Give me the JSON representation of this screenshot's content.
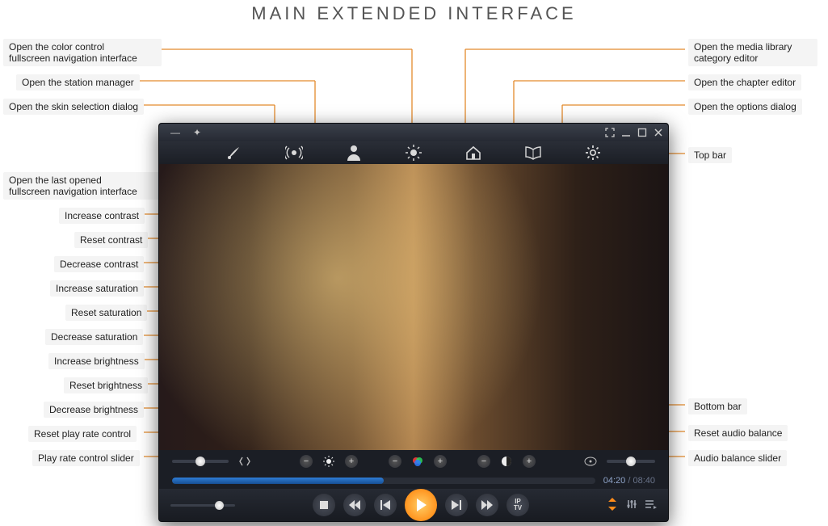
{
  "page_title": "MAIN EXTENDED INTERFACE",
  "labels": {
    "color_nav": "Open the color control\nfullscreen navigation interface",
    "station_mgr": "Open the station manager",
    "skin_dialog": "Open the skin selection dialog",
    "last_nav": "Open the last opened\nfullscreen navigation interface",
    "inc_contrast": "Increase contrast",
    "reset_contrast": "Reset contrast",
    "dec_contrast": "Decrease contrast",
    "inc_sat": "Increase saturation",
    "reset_sat": "Reset saturation",
    "dec_sat": "Decrease saturation",
    "inc_bright": "Increase brightness",
    "reset_bright": "Reset brightness",
    "dec_bright": "Decrease brightness",
    "reset_rate": "Reset play rate control",
    "rate_slider": "Play rate control slider",
    "media_lib": "Open the media library\ncategory editor",
    "chapter_ed": "Open the chapter editor",
    "options": "Open the options dialog",
    "top_bar": "Top bar",
    "bottom_bar": "Bottom bar",
    "reset_balance": "Reset audio balance",
    "balance_slider": "Audio balance slider"
  },
  "time": {
    "current": "04:20",
    "total": "08:40",
    "sep": " / "
  },
  "iptv_label": "IP\nTV",
  "progress_pct": 50,
  "colors": {
    "accent": "#e38a2c",
    "play": "#ff8c1a"
  }
}
